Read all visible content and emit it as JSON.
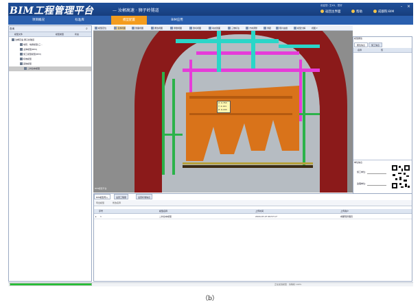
{
  "header": {
    "app_title": "BIM工程管理平台",
    "subtitle": "— 汝郴高速 · 狮子岭隧道",
    "user_info": "欢迎您: 王XX，您好",
    "links": [
      "返回主界面",
      "帮助",
      "成都院·BIM"
    ],
    "window_buttons": [
      "-",
      "×"
    ]
  },
  "nav": {
    "tabs": [
      "项目概况",
      "标准库",
      "模型配置",
      "BIM应用"
    ],
    "active_index": 2
  },
  "left_panel": {
    "search_label": "查询",
    "columns": [
      "模型文件",
      "模型类型",
      "状态"
    ],
    "tree": [
      {
        "label": "汝郴高速·狮子岭隧道",
        "depth": 0
      },
      {
        "label": "地形、地质模型(三...",
        "depth": 1
      },
      {
        "label": "主体模型(BIM)",
        "depth": 1
      },
      {
        "label": "施工模型模型(BIM)",
        "depth": 1
      },
      {
        "label": "机电模型",
        "depth": 1
      },
      {
        "label": "其他模型",
        "depth": 1
      },
      {
        "label": "二衬台车模型",
        "depth": 2,
        "selected": true
      }
    ]
  },
  "viewport": {
    "toolbar": [
      "模型定位",
      "漫游视图",
      "剖面视图",
      "属性视图",
      "测量视图",
      "剖切视图",
      "动态剖面",
      "三维标注",
      "方向调整",
      "测距",
      "照片拍摄",
      "模型分解",
      "视图"
    ],
    "caption": "BIM模型平台",
    "readout": {
      "x": "X: 0.763",
      "y": "Y: 4.141",
      "z": "Z: 6.183"
    },
    "colors": {
      "tunnel": "#8b1a1a",
      "jumbo": "#d9731a",
      "rail": "#2bb24a",
      "pipe": "#2ad6c8",
      "steel": "#e63bd9",
      "ground": "#8d8d8d"
    }
  },
  "right_panel": {
    "title": "模型属性",
    "tabs": [
      "属性信息",
      "施工信息"
    ],
    "columns": [
      "名称",
      "值"
    ],
    "section2_title": "单位信息",
    "fields": [
      "施工单位:",
      "监理单位:"
    ]
  },
  "bottom_panel": {
    "tabs": [
      "BIM模型导入",
      "设置工程量",
      "设置标准信息"
    ],
    "toolbar": [
      "导出模型",
      "修改名称"
    ],
    "columns": [
      "序号",
      "模型名称",
      "上传时间",
      "上传用户"
    ],
    "rows": [
      {
        "index": "1",
        "name": "二衬台车模型",
        "time": "2016-07-27 09:57:17",
        "user": "成都院管理员"
      }
    ]
  },
  "status": {
    "text": "正在加载模型 · 请稍候 100%",
    "progress": 1.0
  },
  "figure_caption": "（b）"
}
